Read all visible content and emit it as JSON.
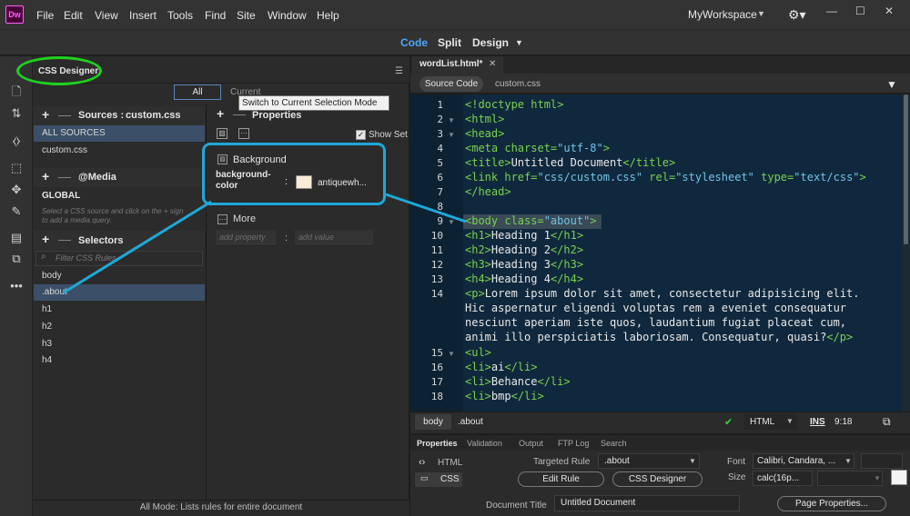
{
  "app": {
    "logo_text": "Dw",
    "menu": [
      "File",
      "Edit",
      "View",
      "Insert",
      "Tools",
      "Find",
      "Site",
      "Window",
      "Help"
    ],
    "workspace": "MyWorkspace",
    "view_buttons": [
      "Code",
      "Split",
      "Design"
    ],
    "accent_color": "#4ea6ff"
  },
  "css_designer": {
    "title": "CSS Designer",
    "tab_all": "All",
    "tab_current": "Current",
    "tooltip": "Switch to Current Selection Mode",
    "sources_label": "Sources :",
    "sources_value": "custom.css",
    "sources": [
      "ALL SOURCES",
      "custom.css"
    ],
    "media_label": "@Media",
    "media_global": "GLOBAL",
    "media_hint_1": "Select a CSS source and click on the + sign",
    "media_hint_2": "to add a media query.",
    "selectors_label": "Selectors",
    "filter_placeholder": "Filter CSS Rules",
    "selectors": [
      "body",
      ".about",
      "h1",
      "h2",
      "h3",
      "h4"
    ],
    "properties_label": "Properties",
    "show_set": "Show Set",
    "background_section": "Background",
    "bg_prop_line1": "background-",
    "bg_prop_line2": "color",
    "bg_colon": ":",
    "bg_value": "antiquewh...",
    "bg_swatch_color": "#faebd7",
    "more_label": "More",
    "add_property": "add property",
    "add_value": "add value",
    "add_colon": ":",
    "status": "All Mode: Lists rules for entire document"
  },
  "editor": {
    "doc_tab": "wordList.html*",
    "source_tabs": [
      "Source Code",
      "custom.css"
    ],
    "line_numbers": [
      "1",
      "2",
      "3",
      "4",
      "5",
      "6",
      "7",
      "8",
      "9",
      "10",
      "11",
      "12",
      "13",
      "14",
      "15",
      "16",
      "17",
      "18"
    ],
    "code": {
      "l1": "<!doctype html>",
      "l2": "<html>",
      "l3": "<head>",
      "l4a": "<meta charset=",
      "l4b": "\"utf-8\"",
      "l4c": ">",
      "l5a": "<title>",
      "l5b": "Untitled Document",
      "l5c": "</title>",
      "l6a": "<link href=",
      "l6b": "\"css/custom.css\"",
      "l6c": " rel=",
      "l6d": "\"stylesheet\"",
      "l6e": " type=",
      "l6f": "\"text/css\"",
      "l6g": ">",
      "l7": "</head>",
      "l9a": "<body class=",
      "l9b": "\"about\"",
      "l9c": ">",
      "l10a": "<h1>",
      "l10b": "Heading 1",
      "l10c": "</h1>",
      "l11a": "<h2>",
      "l11b": "Heading 2",
      "l11c": "</h2>",
      "l12a": "<h3>",
      "l12b": "Heading 3",
      "l12c": "</h3>",
      "l13a": "<h4>",
      "l13b": "Heading 4",
      "l13c": "</h4>",
      "l14a": "<p>",
      "l14b": "Lorem ipsum dolor sit amet, consectetur adipisicing elit.",
      "l14c": "Hic aspernatur eligendi voluptas rem a eveniet consequatur",
      "l14d": "nesciunt aperiam iste quos, laudantium fugiat placeat cum,",
      "l14e": "animi illo perspiciatis laboriosam. Consequatur, quasi?",
      "l14f": "</p>",
      "l15": "<ul>",
      "l16a": "<li>",
      "l16b": "ai",
      "l16c": "</li>",
      "l17a": "<li>",
      "l17b": "Behance",
      "l17c": "</li>",
      "l18a": "<li>",
      "l18b": "bmp",
      "l18c": "</li>"
    },
    "tag_body": "body",
    "tag_about": ".about",
    "language": "HTML",
    "ins": "INS",
    "line_col": "9:18"
  },
  "properties_inspector": {
    "tabs": [
      "Properties",
      "Validation",
      "Output",
      "FTP Log",
      "Search"
    ],
    "html": "HTML",
    "css": "CSS",
    "targeted_rule_label": "Targeted Rule",
    "targeted_rule": ".about",
    "edit_rule": "Edit Rule",
    "css_designer": "CSS Designer",
    "font_label": "Font",
    "font_value": "Calibri, Candara, ...",
    "size_label": "Size",
    "size_value": "calc(16p...",
    "document_title_label": "Document Title",
    "document_title": "Untitled Document",
    "page_properties": "Page Properties..."
  },
  "annotations": {
    "circle_color": "#1fd11f",
    "highlight_color": "#1fa8d8"
  }
}
